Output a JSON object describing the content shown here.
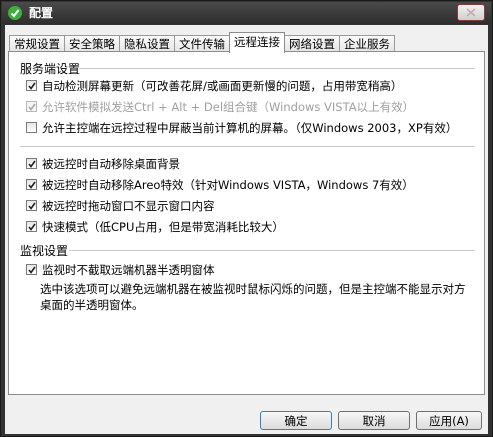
{
  "window": {
    "title": "配置"
  },
  "tabs": [
    {
      "label": "常规设置",
      "active": false
    },
    {
      "label": "安全策略",
      "active": false
    },
    {
      "label": "隐私设置",
      "active": false
    },
    {
      "label": "文件传输",
      "active": false
    },
    {
      "label": "远程连接",
      "active": true
    },
    {
      "label": "网络设置",
      "active": false
    },
    {
      "label": "企业服务",
      "active": false
    }
  ],
  "server": {
    "title": "服务端设置",
    "options": [
      {
        "label": "自动检测屏幕更新（可改善花屏/或画面更新慢的问题，占用带宽稍高）",
        "checked": true,
        "disabled": false
      },
      {
        "label": "允许软件模拟发送Ctrl + Alt + Del组合键（Windows VISTA以上有效）",
        "checked": true,
        "disabled": true
      },
      {
        "label": "允许主控端在远控过程中屏蔽当前计算机的屏幕。（仅Windows 2003，XP有效）",
        "checked": false,
        "disabled": false
      }
    ]
  },
  "remote": {
    "options": [
      {
        "label": "被远控时自动移除桌面背景",
        "checked": true
      },
      {
        "label": "被远控时自动移除Areo特效（针对Windows VISTA，Windows 7有效）",
        "checked": true
      },
      {
        "label": "被远控时拖动窗口不显示窗口内容",
        "checked": true
      },
      {
        "label": "快速模式（低CPU占用，但是带宽消耗比较大）",
        "checked": true
      }
    ]
  },
  "monitor": {
    "title": "监视设置",
    "option": {
      "label": "监视时不截取远端机器半透明窗体",
      "checked": true
    },
    "description": "选中该选项可以避免远端机器在被监视时鼠标闪烁的问题，但是主控端不能显示对方桌面的半透明窗体。"
  },
  "buttons": {
    "ok": "确定",
    "cancel": "取消",
    "apply": "应用(A)"
  },
  "colors": {
    "titlebar": "#333333",
    "accent": "#3c7fb1"
  }
}
